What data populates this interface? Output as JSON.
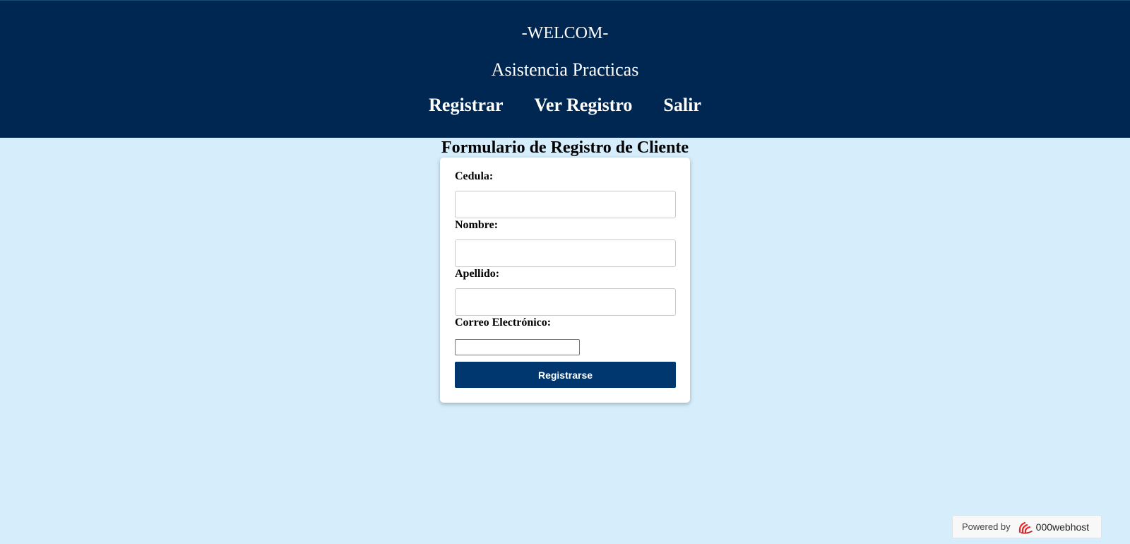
{
  "colors": {
    "header_bg": "#002752",
    "page_bg": "#d6edfc",
    "button_bg": "#00376f",
    "brand_accent": "#e8262a"
  },
  "header": {
    "title": "-WELCOM-",
    "subtitle": "Asistencia Practicas",
    "nav": [
      {
        "label": "Registrar"
      },
      {
        "label": "Ver Registro"
      },
      {
        "label": "Salir"
      }
    ]
  },
  "form": {
    "title": "Formulario de Registro de Cliente",
    "fields": {
      "cedula": {
        "label": "Cedula:",
        "value": ""
      },
      "nombre": {
        "label": "Nombre:",
        "value": ""
      },
      "apellido": {
        "label": "Apellido:",
        "value": ""
      },
      "correo": {
        "label": "Correo Electrónico:",
        "value": ""
      }
    },
    "submit_label": "Registrarse"
  },
  "footer_badge": {
    "powered_by": "Powered by",
    "brand": "000webhost",
    "logo_icon": "000webhost-logo-icon"
  }
}
